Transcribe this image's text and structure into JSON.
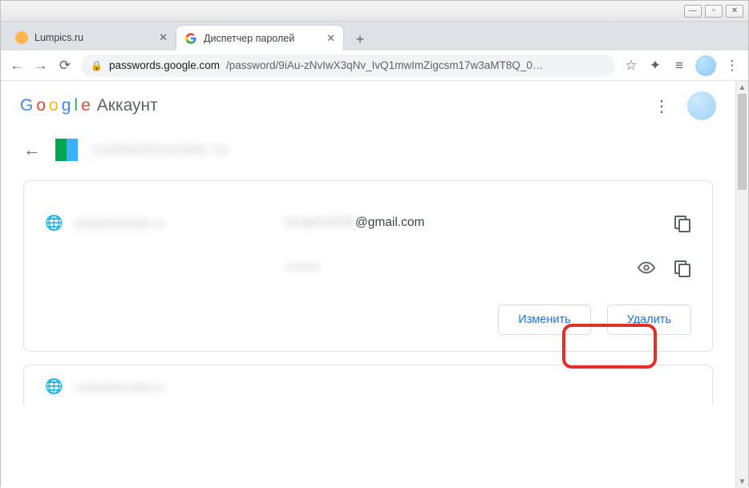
{
  "window": {
    "minimize": "—",
    "maximize": "▫",
    "close": "✕"
  },
  "tabs": [
    {
      "title": "Lumpics.ru",
      "favicon": "orange"
    },
    {
      "title": "Диспетчер паролей",
      "favicon": "google"
    }
  ],
  "newTab": "+",
  "toolbar": {
    "back": "←",
    "forward": "→",
    "reload": "⟳",
    "lock": "🔒",
    "url_host": "passwords.google.com",
    "url_path": "/password/9iAu-zNvIwX3qNv_IvQ1mwImZigcsm17w3aMT8Q_0…",
    "star": "☆",
    "ext": "✦",
    "reading": "≡",
    "menu": "⋮"
  },
  "header": {
    "logo_letters": [
      "G",
      "o",
      "o",
      "g",
      "l",
      "e"
    ],
    "account_label": "Аккаунт",
    "more": "⋮"
  },
  "page_title": {
    "back": "←",
    "site_name_blur": "contentmonster ru"
  },
  "card": {
    "site_label_blur": "contentmonster ru",
    "email_blur": "lumpics2020",
    "email_suffix": "@gmail.com",
    "password_blur": "••••••••",
    "edit_btn": "Изменить",
    "delete_btn": "Удалить"
  },
  "card2": {
    "site_label": "contentmonster.ru"
  }
}
